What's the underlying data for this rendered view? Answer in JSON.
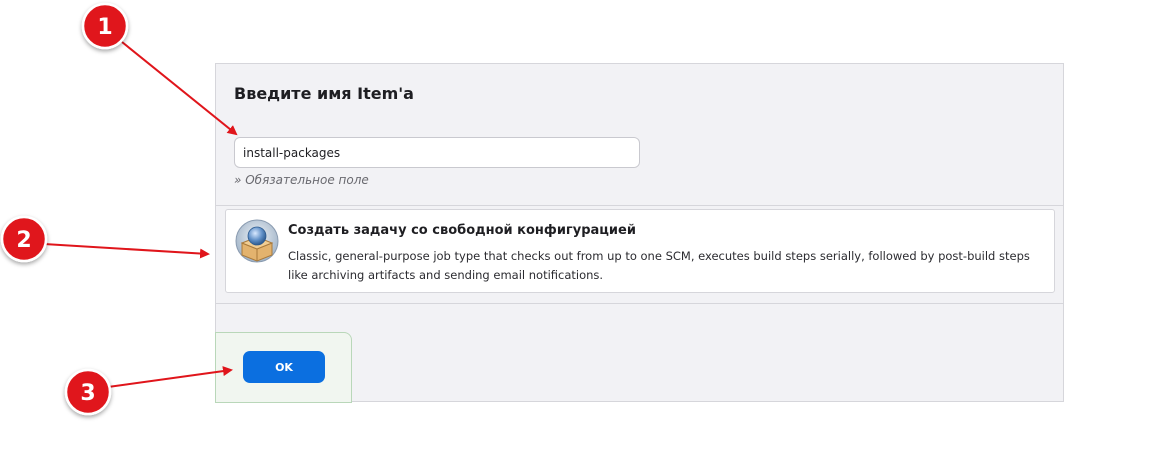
{
  "form": {
    "title": "Введите имя Item'a",
    "name_input_value": "install-packages",
    "required_hint": "» Обязательное поле"
  },
  "job_types": [
    {
      "title": "Создать задачу со свободной конфигурацией",
      "description": "Classic, general-purpose job type that checks out from up to one SCM, executes build steps serially, followed by post-build steps like archiving artifacts and sending email notifications.",
      "icon": "freestyle-project-icon"
    }
  ],
  "footer": {
    "ok_label": "OK"
  },
  "annotations": [
    {
      "number": "1"
    },
    {
      "number": "2"
    },
    {
      "number": "3"
    }
  ],
  "colors": {
    "panel_bg": "#f2f2f5",
    "ok_button": "#0b6fe0",
    "annotation_red": "#e0151b"
  }
}
